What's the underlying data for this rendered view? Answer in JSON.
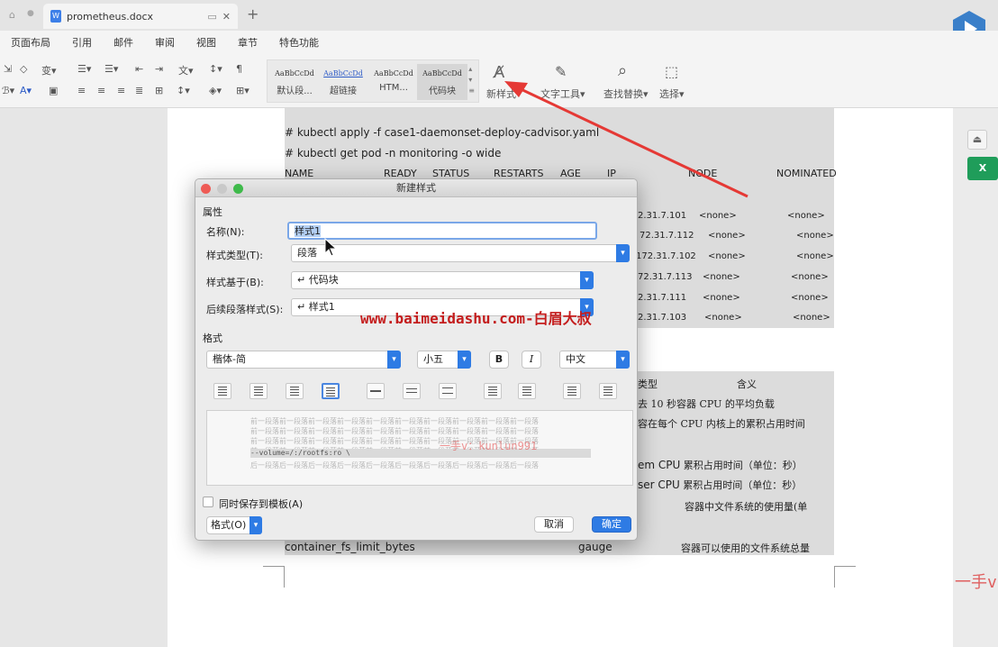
{
  "tab": {
    "title": "prometheus.docx"
  },
  "menu": [
    "页面布局",
    "引用",
    "邮件",
    "审阅",
    "视图",
    "章节",
    "特色功能"
  ],
  "styles": [
    {
      "preview": "AaBbCcDd",
      "label": "默认段..."
    },
    {
      "preview": "AaBbCcDd",
      "label": "超链接"
    },
    {
      "preview": "AaBbCcDd",
      "label": "HTM..."
    },
    {
      "preview": "AaBbCcDd",
      "label": "代码块"
    }
  ],
  "ribbon": {
    "new_style": "新样式",
    "text_tools": "文字工具",
    "find_replace": "查找替换",
    "select": "选择"
  },
  "doc": {
    "cmd1": "# kubectl apply   -f case1-daemonset-deploy-cadvisor.yaml",
    "cmd2": "# kubectl   get pod   -n monitoring  -o wide",
    "headers": [
      "NAME",
      "READY",
      "STATUS",
      "RESTARTS",
      "AGE",
      "IP",
      "NODE",
      "NOMINATED"
    ],
    "rows": [
      [
        "2.31.7.101",
        "<none>",
        "<none>"
      ],
      [
        "72.31.7.112",
        "<none>",
        "<none>"
      ],
      [
        "172.31.7.102",
        "<none>",
        "<none>"
      ],
      [
        "72.31.7.113",
        "<none>",
        "<none>"
      ],
      [
        "2.31.7.111",
        "<none>",
        "<none>"
      ],
      [
        "2.31.7.103",
        "<none>",
        "<none>"
      ]
    ],
    "t_type": "类型",
    "t_meaning": "含义",
    "t1": "去 10 秒容器 CPU 的平均负载",
    "t2": "容在每个 CPU 内核上的累积占用时间",
    "t3a": "em CPU",
    "t3b": "累积占用时间（单位：秒）",
    "t4a": "ser CPU",
    "t4b": "累积占用时间（单位：秒）",
    "t5": "容器中文件系统的使用量(单",
    "t6a": "container_fs_limit_bytes",
    "t6b": "gauge",
    "t6c": "容器可以使用的文件系统总量"
  },
  "dialog": {
    "title": "新建样式",
    "attr": "属性",
    "name_label": "名称(N):",
    "name_value": "样式1",
    "type_label": "样式类型(T):",
    "type_value": "段落",
    "based_label": "样式基于(B):",
    "based_value": "↵ 代码块",
    "next_label": "后续段落样式(S):",
    "next_value": "↵ 样式1",
    "format_section": "格式",
    "font": "楷体-简",
    "size": "小五",
    "bold": "B",
    "italic": "I",
    "lang": "中文",
    "preview_text": "前一段落前一段落前一段落前一段落前一段落前一段落前一段落前一段落前一段落前一段落",
    "preview_sample": "--volume=/:/rootfs:ro \\",
    "preview_after": "后一段落后一段落后一段落后一段落后一段落后一段落后一段落后一段落后一段落后一段落",
    "save_template": "同时保存到模板(A)",
    "format_btn": "格式(O)",
    "cancel": "取消",
    "ok": "确定"
  },
  "watermarks": {
    "site": "www.baimeidashu.com-白眉大叔",
    "wechat": "一手v：kunlun991",
    "edge": "一手v"
  }
}
